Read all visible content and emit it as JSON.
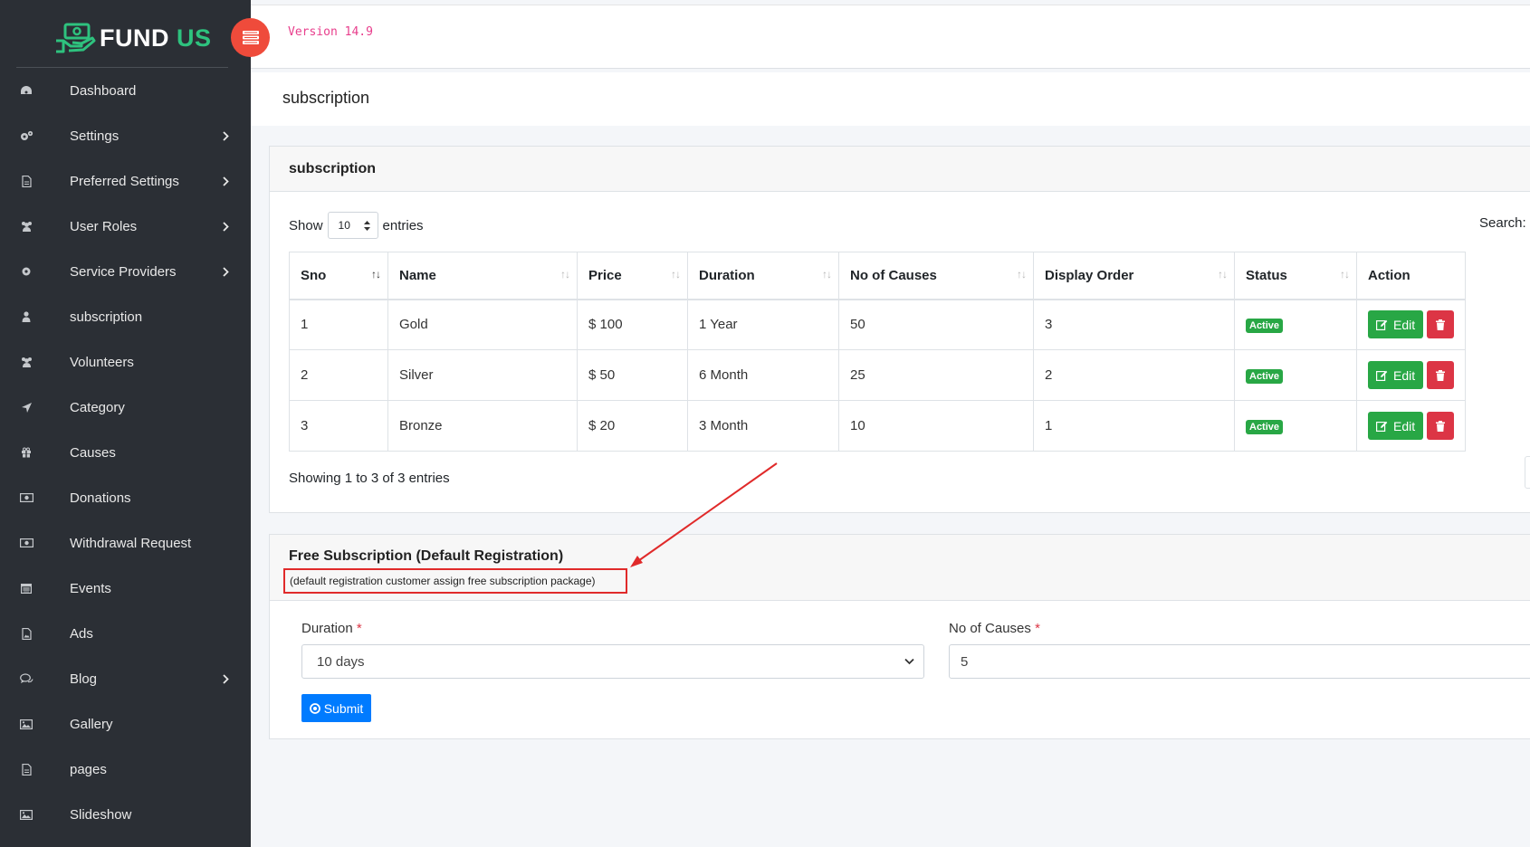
{
  "brand": {
    "name_part1": "FUND",
    "name_part2": "US",
    "accent": "#2ec27e"
  },
  "topbar": {
    "version": "Version 14.9"
  },
  "sidebar": {
    "items": [
      {
        "label": "Dashboard",
        "icon": "dashboard-icon",
        "has_submenu": false
      },
      {
        "label": "Settings",
        "icon": "cogs-icon",
        "has_submenu": true
      },
      {
        "label": "Preferred Settings",
        "icon": "file-icon",
        "has_submenu": true
      },
      {
        "label": "User Roles",
        "icon": "users-icon",
        "has_submenu": true
      },
      {
        "label": "Service Providers",
        "icon": "gear-icon",
        "has_submenu": true
      },
      {
        "label": "subscription",
        "icon": "user-icon",
        "has_submenu": false
      },
      {
        "label": "Volunteers",
        "icon": "users-icon",
        "has_submenu": false
      },
      {
        "label": "Category",
        "icon": "location-arrow-icon",
        "has_submenu": false
      },
      {
        "label": "Causes",
        "icon": "gift-icon",
        "has_submenu": false
      },
      {
        "label": "Donations",
        "icon": "money-icon",
        "has_submenu": false
      },
      {
        "label": "Withdrawal Request",
        "icon": "money-icon",
        "has_submenu": false
      },
      {
        "label": "Events",
        "icon": "calendar-icon",
        "has_submenu": false
      },
      {
        "label": "Ads",
        "icon": "image-file-icon",
        "has_submenu": false
      },
      {
        "label": "Blog",
        "icon": "comments-icon",
        "has_submenu": true
      },
      {
        "label": "Gallery",
        "icon": "picture-icon",
        "has_submenu": false
      },
      {
        "label": "pages",
        "icon": "file-icon",
        "has_submenu": false
      },
      {
        "label": "Slideshow",
        "icon": "picture-icon",
        "has_submenu": false
      }
    ]
  },
  "page": {
    "title": "subscription"
  },
  "subscription_card": {
    "title": "subscription",
    "show_label": "Show",
    "entries_value": "10",
    "entries_label": "entries",
    "search_label": "Search:",
    "columns": [
      "Sno",
      "Name",
      "Price",
      "Duration",
      "No of Causes",
      "Display Order",
      "Status",
      "Action"
    ],
    "rows": [
      {
        "sno": "1",
        "name": "Gold",
        "price": "$ 100",
        "duration": "1 Year",
        "causes": "50",
        "order": "3",
        "status": "Active"
      },
      {
        "sno": "2",
        "name": "Silver",
        "price": "$ 50",
        "duration": "6 Month",
        "causes": "25",
        "order": "2",
        "status": "Active"
      },
      {
        "sno": "3",
        "name": "Bronze",
        "price": "$ 20",
        "duration": "3 Month",
        "causes": "10",
        "order": "1",
        "status": "Active"
      }
    ],
    "edit_label": "Edit",
    "info": "Showing 1 to 3 of 3 entries"
  },
  "free_card": {
    "title": "Free Subscription (Default Registration)",
    "note": "(default registration customer assign free subscription package)",
    "duration_label": "Duration",
    "duration_value": "10 days",
    "causes_label": "No of Causes",
    "causes_value": "5",
    "required_mark": "*",
    "submit_label": "Submit"
  },
  "colors": {
    "sidebar_bg": "#2b2f35",
    "active_badge": "#28a745",
    "delete": "#dc3545",
    "primary": "#007bff",
    "annotation": "#e02a2a",
    "toggle": "#ef4b3b"
  }
}
